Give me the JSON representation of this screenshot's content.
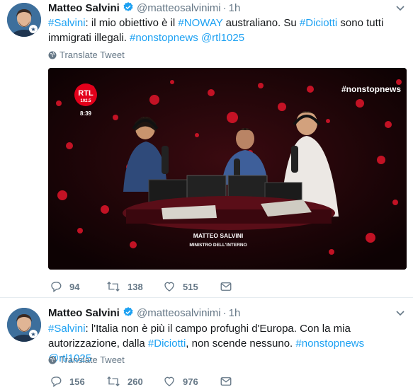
{
  "tweets": [
    {
      "author": "Matteo Salvini",
      "handle": "@matteosalvinimi",
      "time": "1h",
      "text_parts": [
        {
          "t": "#Salvini",
          "link": true
        },
        {
          "t": ": il mio obiettivo è il ",
          "link": false
        },
        {
          "t": "#NOWAY",
          "link": true
        },
        {
          "t": " australiano. Su ",
          "link": false
        },
        {
          "t": "#Diciotti",
          "link": true
        },
        {
          "t": " sono tutti immigrati illegali. ",
          "link": false
        },
        {
          "t": "#nonstopnews",
          "link": true
        },
        {
          "t": " ",
          "link": false
        },
        {
          "t": "@rtl1025",
          "link": true
        }
      ],
      "translate": "Translate Tweet",
      "media": {
        "hashtag": "#nonstopnews",
        "logo": "RTL",
        "logo_freq": "102.5",
        "clock": "8:39",
        "caption_name": "MATTEO SALVINI",
        "caption_role": "MINISTRO DELL'INTERNO"
      },
      "replies": "94",
      "retweets": "138",
      "likes": "515"
    },
    {
      "author": "Matteo Salvini",
      "handle": "@matteosalvinimi",
      "time": "1h",
      "text_parts": [
        {
          "t": "#Salvini",
          "link": true
        },
        {
          "t": ": l'Italia non è più il campo profughi d'Europa. Con la mia autorizzazione, dalla ",
          "link": false
        },
        {
          "t": "#Diciotti",
          "link": true
        },
        {
          "t": ", non scende nessuno. ",
          "link": false
        },
        {
          "t": "#nonstopnews",
          "link": true
        },
        {
          "t": " ",
          "link": false
        },
        {
          "t": "@rtl1025",
          "link": true
        }
      ],
      "translate": "Translate Tweet",
      "replies": "156",
      "retweets": "260",
      "likes": "976"
    }
  ],
  "colors": {
    "link": "#1da1f2",
    "secondary": "#657786",
    "verified": "#1da1f2"
  },
  "icons": [
    "verified-badge-icon",
    "caret-down-icon",
    "globe-icon",
    "reply-icon",
    "retweet-icon",
    "like-icon",
    "message-icon"
  ]
}
